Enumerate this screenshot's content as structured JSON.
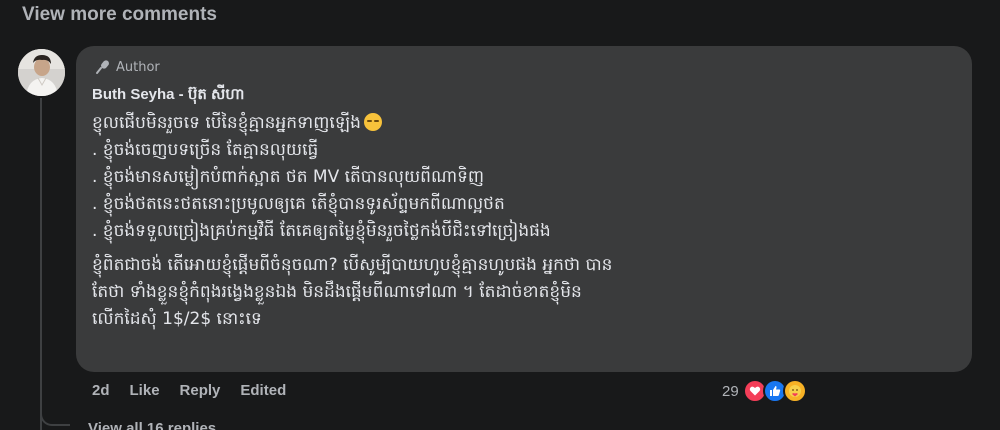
{
  "top": {
    "view_more_label": "View more comments"
  },
  "comment": {
    "badge_label": "Author",
    "author_name": "Buth Seyha - ប៊ុត សីហា",
    "lines": [
      "ខ្ញុំចង់ចេញបទច្រើន តែគ្មានលុយធ្វើ",
      ". ខ្ញុំចង់មានសម្លៀកបំពាក់ស្អាត ថត MV តើបានលុយពីណាទិញ",
      ". ខ្ញុំចង់ថតនេះថតនោះប្រមូលឲ្យគេ តើខ្ញុំបានទូរស័ព្ទមកពីណាល្អថត",
      ". ខ្ញុំចង់ទទួលច្រៀងគ្រប់កម្មវិធី តែគេឲ្យតម្លៃខ្ញុំមិនរួចថ្លៃកង់បីជិះទៅច្រៀងផង"
    ],
    "first_line": "ខ្ញុលផើបមិនរួចទេ បើនៃខ្ញុំគ្មានអ្នកទាញឡើង",
    "first_bullet": ". ខ្ញុំចង់ចេញបទច្រើន តែគ្មានលុយធ្វើ",
    "paragraph_lines": [
      "ខ្ញុំពិតជាចង់ តើអោយខ្ញុំផ្តើមពីចំនុចណា? បើសូម្បីបាយហូបខ្ញុំគ្មានហូបផង អ្នកថា បាន",
      "តែថា ទាំងខ្លួនខ្ញុំកំពុងរង្វេងខ្លួនឯង មិនដឹងផ្តើមពីណាទៅណា ។ តែដាច់ខាតខ្ញុំមិន",
      "លើកដៃសុំ 1$/2$ នោះទេ"
    ],
    "actions": {
      "time": "2d",
      "like_label": "Like",
      "reply_label": "Reply",
      "edited_label": "Edited"
    },
    "reactions": {
      "count": "29",
      "types": [
        "love",
        "like",
        "care"
      ]
    }
  },
  "bottom": {
    "view_all_label": "View all 16 replies"
  },
  "colors": {
    "background": "#18191a",
    "bubble": "#3a3b3c",
    "text": "#e4e6eb",
    "secondary": "#b0b3b8",
    "love": "#f33e58",
    "like": "#1877f2",
    "care": "#f7b125"
  }
}
